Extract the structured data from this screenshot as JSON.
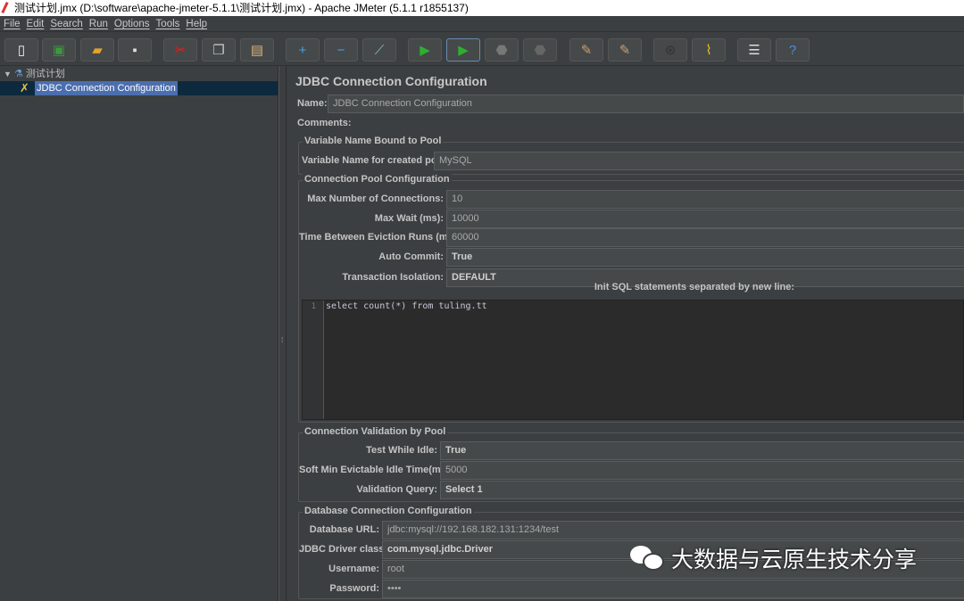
{
  "window": {
    "title": "测试计划.jmx (D:\\software\\apache-jmeter-5.1.1\\测试计划.jmx) - Apache JMeter (5.1.1 r1855137)"
  },
  "menu": [
    "File",
    "Edit",
    "Search",
    "Run",
    "Options",
    "Tools",
    "Help"
  ],
  "toolbar": [
    {
      "name": "new-icon",
      "glyph": "▯",
      "color": "#f4f4f4"
    },
    {
      "name": "templates-icon",
      "glyph": "▣",
      "color": "#3b9a3b"
    },
    {
      "name": "open-icon",
      "glyph": "▰",
      "color": "#e3a42a"
    },
    {
      "name": "save-icon",
      "glyph": "▪",
      "color": "#ddd"
    },
    {
      "name": "cut-icon",
      "glyph": "✂",
      "color": "#d22"
    },
    {
      "name": "copy-icon",
      "glyph": "❐",
      "color": "#ccc"
    },
    {
      "name": "paste-icon",
      "glyph": "▤",
      "color": "#d9b27a"
    },
    {
      "name": "expand-icon",
      "glyph": "+",
      "color": "#4a9ee8"
    },
    {
      "name": "collapse-icon",
      "glyph": "−",
      "color": "#4a9ee8"
    },
    {
      "name": "toggle-icon",
      "glyph": "⟋",
      "color": "#8bc"
    },
    {
      "name": "start-icon",
      "glyph": "▶",
      "color": "#2fae2f"
    },
    {
      "name": "start-no-pauses-icon",
      "glyph": "▶",
      "color": "#2fae2f"
    },
    {
      "name": "stop-icon",
      "glyph": "⬣",
      "color": "#777"
    },
    {
      "name": "shutdown-icon",
      "glyph": "⬣",
      "color": "#666"
    },
    {
      "name": "clear-icon",
      "glyph": "✎",
      "color": "#c9a070"
    },
    {
      "name": "clear-all-icon",
      "glyph": "✎",
      "color": "#c9a070"
    },
    {
      "name": "search-icon",
      "glyph": "⊛",
      "color": "#333"
    },
    {
      "name": "reset-search-icon",
      "glyph": "⌇",
      "color": "#e8c020"
    },
    {
      "name": "function-helper-icon",
      "glyph": "☰",
      "color": "#ddd"
    },
    {
      "name": "help-icon",
      "glyph": "?",
      "color": "#4a8ee0"
    }
  ],
  "tree": {
    "root": "测试计划",
    "child": "JDBC Connection Configuration"
  },
  "panel": {
    "title": "JDBC Connection Configuration",
    "name_label": "Name:",
    "name_value": "JDBC Connection Configuration",
    "comments_label": "Comments:",
    "pool_bound": {
      "title": "Variable Name Bound to Pool",
      "var_label": "Variable Name for created pool:",
      "var_value": "MySQL"
    },
    "pool_config": {
      "title": "Connection Pool Configuration",
      "rows": [
        {
          "label": "Max Number of Connections:",
          "value": "10"
        },
        {
          "label": "Max Wait (ms):",
          "value": "10000"
        },
        {
          "label": "Time Between Eviction Runs (ms):",
          "value": "60000"
        },
        {
          "label": "Auto Commit:",
          "value": "True"
        },
        {
          "label": "Transaction Isolation:",
          "value": "DEFAULT"
        }
      ],
      "init_sql_label": "Init SQL statements separated by new line:",
      "init_sql_line_no": "1",
      "init_sql": "select count(*) from tuling.tt"
    },
    "validation": {
      "title": "Connection Validation by Pool",
      "rows": [
        {
          "label": "Test While Idle:",
          "value": "True"
        },
        {
          "label": "Soft Min Evictable Idle Time(ms):",
          "value": "5000"
        },
        {
          "label": "Validation Query:",
          "value": "Select 1"
        }
      ]
    },
    "database": {
      "title": "Database Connection Configuration",
      "rows": [
        {
          "label": "Database URL:",
          "value": "jdbc:mysql://192.168.182.131:1234/test"
        },
        {
          "label": "JDBC Driver class:",
          "value": "com.mysql.jdbc.Driver"
        },
        {
          "label": "Username:",
          "value": "root"
        },
        {
          "label": "Password:",
          "value": "••••"
        }
      ]
    }
  },
  "watermark": "大数据与云原生技术分享"
}
